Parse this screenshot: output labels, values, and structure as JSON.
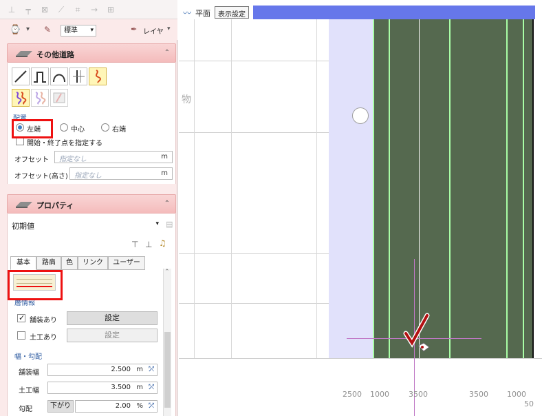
{
  "left_panel": {
    "toolbar_top": {
      "icons": [
        "wall-icon",
        "align-icon",
        "delete-icon",
        "line-icon",
        "grid-icon",
        "arrow-icon",
        "table-icon"
      ]
    },
    "toolbar_second": {
      "mode_dropdown": "標準",
      "layer_label": "レイヤ"
    },
    "section_other_road": {
      "title": "その他道路",
      "placement": {
        "label": "配置",
        "options": [
          "左端",
          "中心",
          "右端"
        ],
        "selected": "左端"
      },
      "start_end_checkbox": "開始・終了点を指定する",
      "offset": {
        "label": "オフセット",
        "placeholder": "指定なし",
        "unit": "m"
      },
      "offset_height": {
        "label": "オフセット(高さ)",
        "placeholder": "指定なし",
        "unit": "m"
      }
    },
    "section_property": {
      "title": "プロパティ",
      "preset": "初期値",
      "tabs": [
        "基本",
        "路肩",
        "色",
        "リンク",
        "ユーザー"
      ],
      "layer_info_label": "層情報",
      "paved": {
        "label": "舗装あり",
        "button": "設定"
      },
      "earthwork": {
        "label": "土工あり",
        "button": "設定"
      },
      "width_slope_label": "幅・勾配",
      "paved_width": {
        "label": "舗装幅",
        "value": "2.500",
        "unit": "m"
      },
      "earth_width": {
        "label": "土工幅",
        "value": "3.500",
        "unit": "m"
      },
      "slope": {
        "label": "勾配",
        "direction": "下がり",
        "value": "2.00",
        "unit": "%"
      }
    }
  },
  "main_view": {
    "view_name": "平面",
    "display_settings": "表示設定",
    "canvas_text": "物",
    "ruler_labels": [
      "2500",
      "1000",
      "3500",
      "3500",
      "1000",
      "50"
    ]
  },
  "colors": {
    "panel_pink": "#fbeaea",
    "section_pink": "#f4bcbc",
    "accent_blue": "#6677ea",
    "green_road": "#55694f",
    "highlight_red": "#ee1111",
    "crosshair": "#c078c6"
  }
}
